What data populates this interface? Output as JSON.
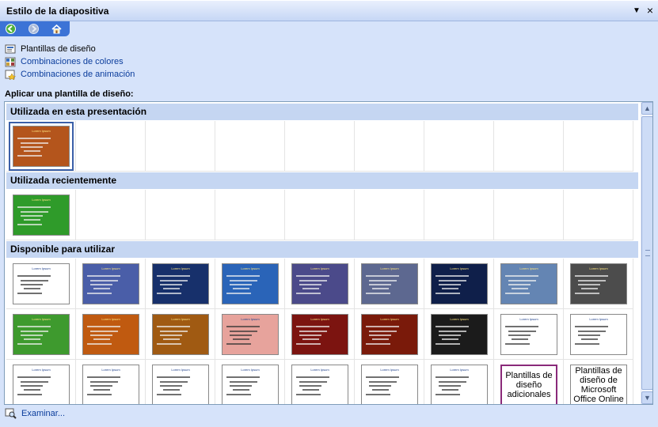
{
  "panel": {
    "title": "Estilo de la diapositiva",
    "close": "×",
    "menu_arrow": "▼"
  },
  "nav": {
    "back": "◄",
    "forward": "►",
    "home": "⌂"
  },
  "links": [
    {
      "label": "Plantillas de diseño",
      "icon": "design-templates-icon"
    },
    {
      "label": "Combinaciones de colores",
      "icon": "color-schemes-icon"
    },
    {
      "label": "Combinaciones de animación",
      "icon": "animation-schemes-icon"
    }
  ],
  "apply_label": "Aplicar una plantilla de diseño:",
  "sections": [
    {
      "title": "Utilizada en esta presentación"
    },
    {
      "title": "Utilizada recientemente"
    },
    {
      "title": "Disponible para utilizar"
    }
  ],
  "thumb_title": "Lorem Ipsum",
  "special_thumbs": [
    "Plantillas de diseño adicionales",
    "Plantillas de diseño de Microsoft Office Online"
  ],
  "colors": {
    "current": "#b4551c",
    "recent": "#2f9b2a",
    "available": [
      "#ffffff",
      "#4a5ea8",
      "#17306b",
      "#2a64b8",
      "#4b4a8a",
      "#5d6890",
      "#0f1f4a",
      "#6485b3",
      "#4c4c4c",
      "#3e9a2e",
      "#c05a10",
      "#a05a12",
      "#e7a39c",
      "#7c1410",
      "#7a1a0a",
      "#1b1b1b",
      "#ffffff",
      "#ffffff",
      "#ffffff",
      "#ffffff",
      "#ffffff",
      "#ffffff",
      "#ffffff",
      "#ffffff",
      "#ffffff"
    ]
  },
  "browse": {
    "label": "Examinar..."
  }
}
